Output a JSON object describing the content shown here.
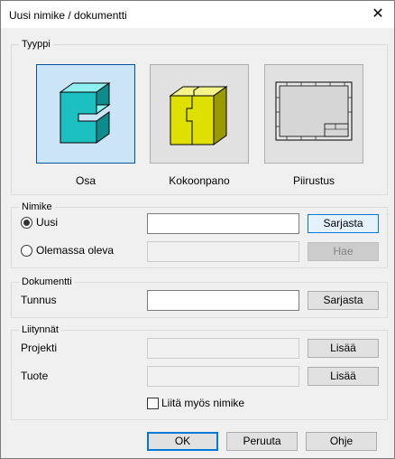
{
  "window": {
    "title": "Uusi nimike / dokumentti",
    "close_icon": "close-icon"
  },
  "type_group": {
    "label": "Tyyppi",
    "options": [
      {
        "label": "Osa",
        "icon": "part-icon",
        "selected": true
      },
      {
        "label": "Kokoonpano",
        "icon": "assembly-icon",
        "selected": false
      },
      {
        "label": "Piirustus",
        "icon": "drawing-icon",
        "selected": false
      }
    ]
  },
  "item_group": {
    "label": "Nimike",
    "new_radio": {
      "label": "Uusi",
      "checked": true
    },
    "new_input_value": "",
    "series_button": "Sarjasta",
    "existing_radio": {
      "label": "Olemassa oleva",
      "checked": false
    },
    "existing_input_value": "",
    "fetch_button": "Hae"
  },
  "document_group": {
    "label": "Dokumentti",
    "id_label": "Tunnus",
    "id_value": "",
    "series_button": "Sarjasta"
  },
  "attachments_group": {
    "label": "Liitynnät",
    "project_label": "Projekti",
    "project_value": "",
    "project_add_button": "Lisää",
    "product_label": "Tuote",
    "product_value": "",
    "product_add_button": "Lisää",
    "attach_item_checkbox": {
      "label": "Liitä myös nimike",
      "checked": false
    }
  },
  "footer": {
    "ok": "OK",
    "cancel": "Peruuta",
    "help": "Ohje"
  },
  "colors": {
    "accent": "#0078d7",
    "selection": "#cce4f7",
    "part": "#1cc0c0",
    "assembly": "#e0e000"
  }
}
